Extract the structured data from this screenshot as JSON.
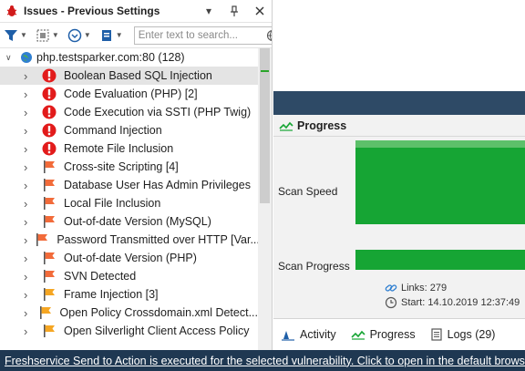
{
  "issues_panel": {
    "title": "Issues - Previous Settings",
    "search_placeholder": "Enter text to search...",
    "root": {
      "label": "php.testsparker.com:80 (128)"
    },
    "items": [
      {
        "label": "Boolean Based SQL Injection",
        "severity": "critical",
        "selected": true
      },
      {
        "label": "Code Evaluation (PHP) [2]",
        "severity": "critical"
      },
      {
        "label": "Code Execution via SSTI (PHP Twig)",
        "severity": "critical"
      },
      {
        "label": "Command Injection",
        "severity": "critical"
      },
      {
        "label": "Remote File Inclusion",
        "severity": "critical"
      },
      {
        "label": "Cross-site Scripting [4]",
        "severity": "high"
      },
      {
        "label": "Database User Has Admin Privileges",
        "severity": "high"
      },
      {
        "label": "Local File Inclusion",
        "severity": "high"
      },
      {
        "label": "Out-of-date Version (MySQL)",
        "severity": "high"
      },
      {
        "label": "Password Transmitted over HTTP [Var...",
        "severity": "high"
      },
      {
        "label": "Out-of-date Version (PHP)",
        "severity": "high"
      },
      {
        "label": "SVN Detected",
        "severity": "high"
      },
      {
        "label": "Frame Injection [3]",
        "severity": "medium"
      },
      {
        "label": "Open Policy Crossdomain.xml Detect...",
        "severity": "medium"
      },
      {
        "label": "Open Silverlight Client Access Policy",
        "severity": "medium"
      }
    ]
  },
  "progress_panel": {
    "title": "Progress",
    "scan_speed_label": "Scan Speed",
    "scan_progress_label": "Scan Progress",
    "links_text": "Links: 279",
    "start_text": "Start: 14.10.2019 12:37:49"
  },
  "bottom_tabs": [
    {
      "label": "Activity",
      "icon": "activity-icon"
    },
    {
      "label": "Progress",
      "icon": "progress-icon"
    },
    {
      "label": "Logs (29)",
      "icon": "logs-icon"
    }
  ],
  "status_bar": {
    "message": "Freshservice Send to Action is executed for the selected vulnerability. Click to open in the default browser."
  },
  "colors": {
    "critical": "#e21b1b",
    "high": "#f26b3a",
    "medium": "#f5a623",
    "progress_green": "#16a534",
    "status_bar_bg": "#1f3852"
  }
}
